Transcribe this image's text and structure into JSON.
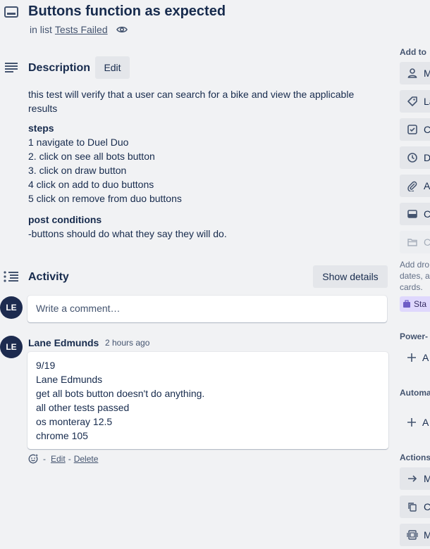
{
  "card": {
    "title": "Buttons function as expected",
    "in_list_prefix": "in list",
    "list_name": "Tests Failed"
  },
  "description": {
    "heading": "Description",
    "edit_label": "Edit",
    "intro": "this test will verify that a user can search for a bike and view the applicable results",
    "steps_heading": "steps",
    "steps": [
      "1 navigate to Duel Duo",
      "2. click on see all bots button",
      "3. click on draw button",
      "4 click on add to duo buttons",
      "5 click on remove from duo buttons"
    ],
    "post_heading": "post conditions",
    "post_text": "-buttons should do what they say they will do."
  },
  "activity": {
    "heading": "Activity",
    "show_details_label": "Show details",
    "avatar_initials": "LE",
    "comment_placeholder": "Write a comment…",
    "comment": {
      "author": "Lane Edmunds",
      "time": "2 hours ago",
      "lines": [
        "9/19",
        "Lane Edmunds",
        "get all bots button doesn't do anything.",
        "all other tests passed",
        "os monteray 12.5",
        "chrome 105"
      ],
      "sep1": "-",
      "edit_label": "Edit",
      "sep2": "-",
      "delete_label": "Delete"
    }
  },
  "sidebar": {
    "add_to_card_heading": "Add to",
    "add_items": [
      {
        "label": "M",
        "icon": "person-icon"
      },
      {
        "label": "La",
        "icon": "label-icon"
      },
      {
        "label": "C",
        "icon": "checklist-icon"
      },
      {
        "label": "D",
        "icon": "clock-icon"
      },
      {
        "label": "At",
        "icon": "paperclip-icon"
      },
      {
        "label": "C",
        "icon": "cover-icon"
      },
      {
        "label": "C",
        "icon": "folder-icon"
      }
    ],
    "note": [
      "Add dro",
      "dates, a",
      "cards."
    ],
    "star_chip": "Sta",
    "powerups_heading": "Power-",
    "powerups_add": "A",
    "automation_heading": "Automa",
    "automation_add": "A",
    "actions_heading": "Actions",
    "action_items": [
      {
        "label": "M",
        "icon": "arrow-right-icon"
      },
      {
        "label": "C",
        "icon": "copy-icon"
      },
      {
        "label": "M",
        "icon": "template-icon"
      }
    ]
  }
}
